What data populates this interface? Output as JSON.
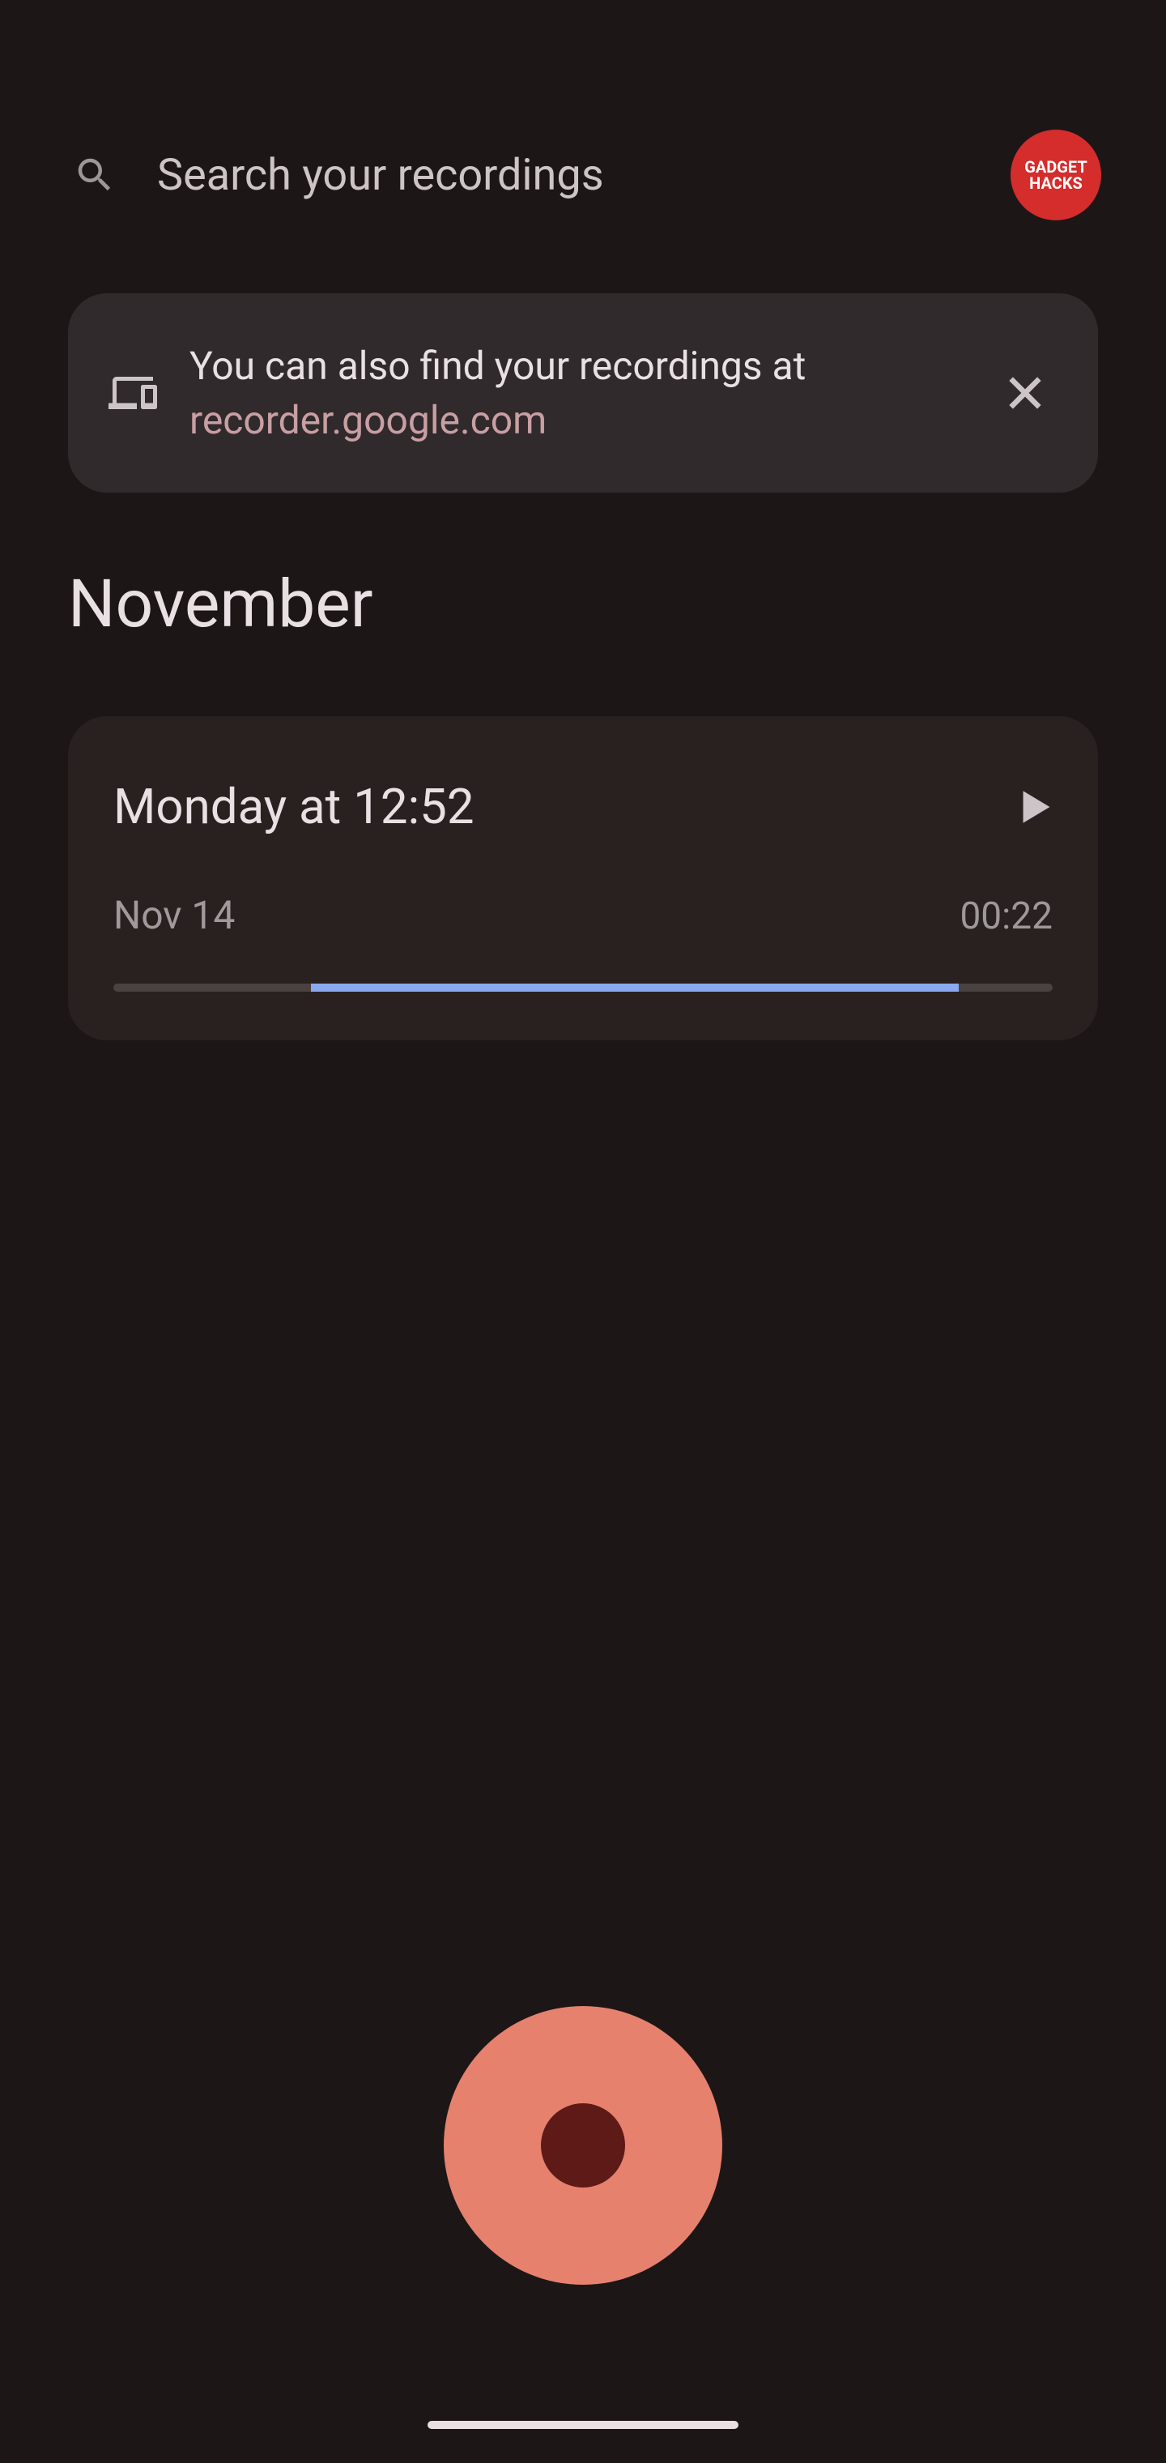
{
  "search": {
    "placeholder": "Search your recordings"
  },
  "avatar": {
    "line1": "GADGET",
    "line2": "HACKS"
  },
  "banner": {
    "text": "You can also find your recordings at",
    "link": "recorder.google.com"
  },
  "month_header": "November",
  "recording": {
    "title": "Monday at 12:52",
    "date": "Nov 14",
    "duration": "00:22"
  }
}
